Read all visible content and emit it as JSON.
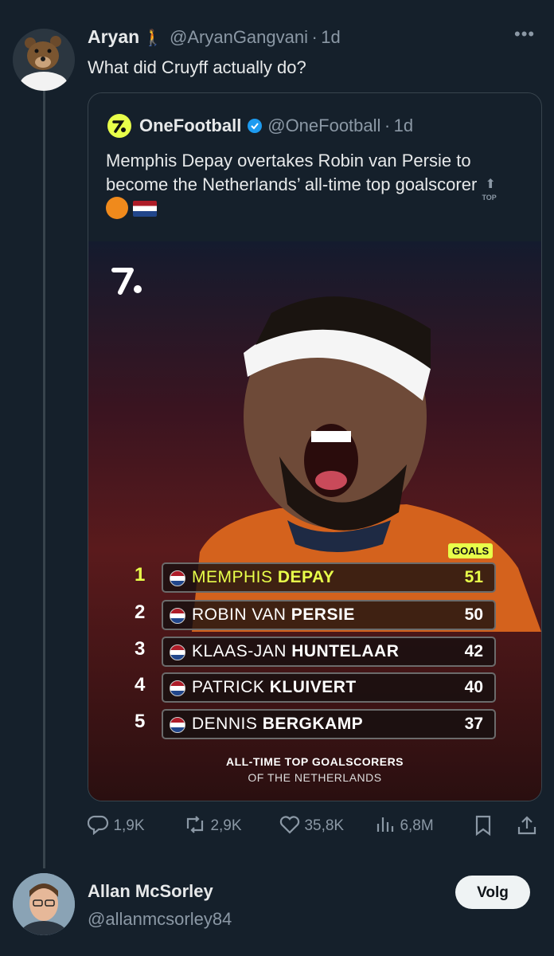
{
  "tweet": {
    "author_name": "Aryan",
    "author_emoji": "🚶",
    "handle": "@AryanGangvani",
    "time": "1d",
    "text": "What did Cruyff actually do?"
  },
  "quote": {
    "author_name": "OneFootball",
    "handle": "@OneFootball",
    "time": "1d",
    "text": "Memphis Depay overtakes Robin van Persie to become the Netherlands’ all-time top goalscorer",
    "emojis": "⬆️🟠🇳🇱",
    "top_badge": "TOP"
  },
  "graphic": {
    "goals_label": "GOALS",
    "caption_line1": "ALL-TIME TOP GOALSCORERS",
    "caption_line2": "OF THE NETHERLANDS",
    "rows": [
      {
        "rank": "1",
        "first": "MEMPHIS ",
        "last": "DEPAY",
        "goals": "51"
      },
      {
        "rank": "2",
        "first": "ROBIN VAN ",
        "last": "PERSIE",
        "goals": "50"
      },
      {
        "rank": "3",
        "first": "KLAAS-JAN ",
        "last": "HUNTELAAR",
        "goals": "42"
      },
      {
        "rank": "4",
        "first": "PATRICK ",
        "last": "KLUIVERT",
        "goals": "40"
      },
      {
        "rank": "5",
        "first": "DENNIS ",
        "last": "BERGKAMP",
        "goals": "37"
      }
    ],
    "highlight_color": "#e8ff4a"
  },
  "actions": {
    "replies": "1,9K",
    "reposts": "2,9K",
    "likes": "35,8K",
    "views": "6,8M"
  },
  "reply": {
    "author_name": "Allan McSorley",
    "handle": "@allanmcsorley84",
    "follow_label": "Volg"
  },
  "colors": {
    "background": "#15202b",
    "muted": "#8b98a5",
    "verified": "#1d9bf0"
  }
}
